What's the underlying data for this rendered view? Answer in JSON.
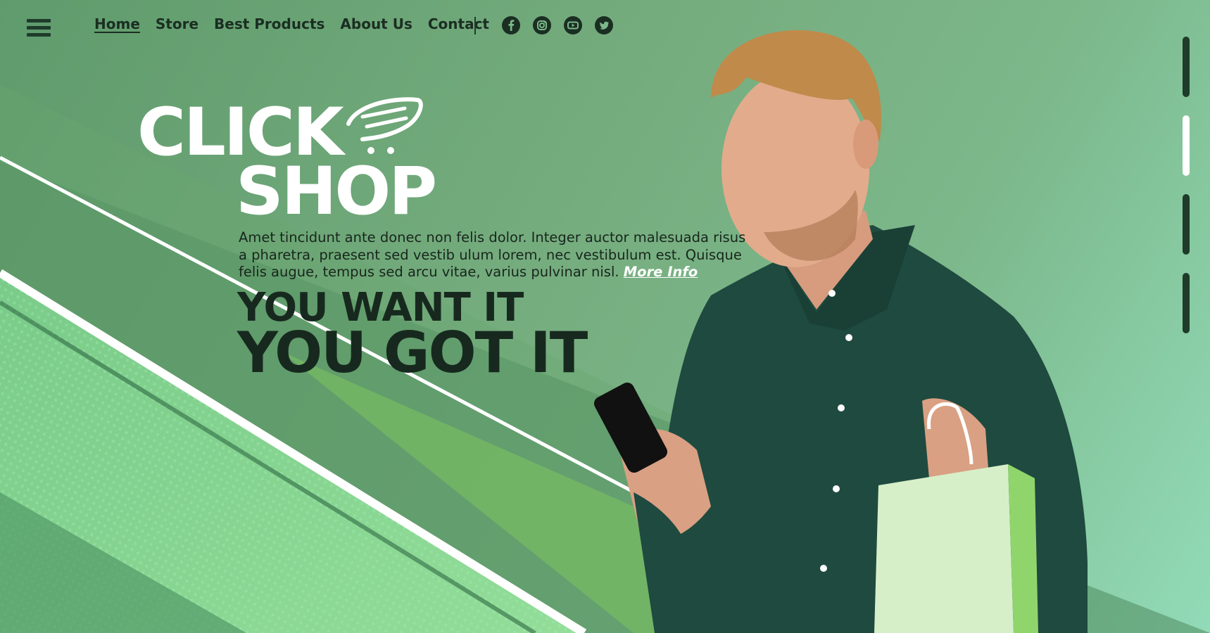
{
  "nav": {
    "items": [
      {
        "label": "Home",
        "active": true
      },
      {
        "label": "Store"
      },
      {
        "label": "Best Products"
      },
      {
        "label": "About Us"
      },
      {
        "label": "Contact"
      }
    ]
  },
  "social": [
    "facebook-icon",
    "instagram-icon",
    "youtube-icon",
    "twitter-icon"
  ],
  "logo": {
    "line1": "CLICK",
    "line2": "SHOP"
  },
  "hero": {
    "description": "Amet tincidunt ante donec non felis dolor. Integer auctor malesuada risus a pharetra, praesent sed vestib ulum lorem, nec vestibulum est. Quisque felis augue, tempus sed arcu vitae, varius pulvinar nisl.",
    "more_info": "More Info",
    "tagline1": "YOU WANT IT",
    "tagline2": "YOU GOT IT"
  },
  "pager": {
    "count": 4,
    "active_index": 1
  },
  "colors": {
    "dark_green": "#1f3b2a",
    "shirt_green": "#1f4a3f",
    "accent_light_green": "#8ee39b",
    "white": "#ffffff"
  }
}
